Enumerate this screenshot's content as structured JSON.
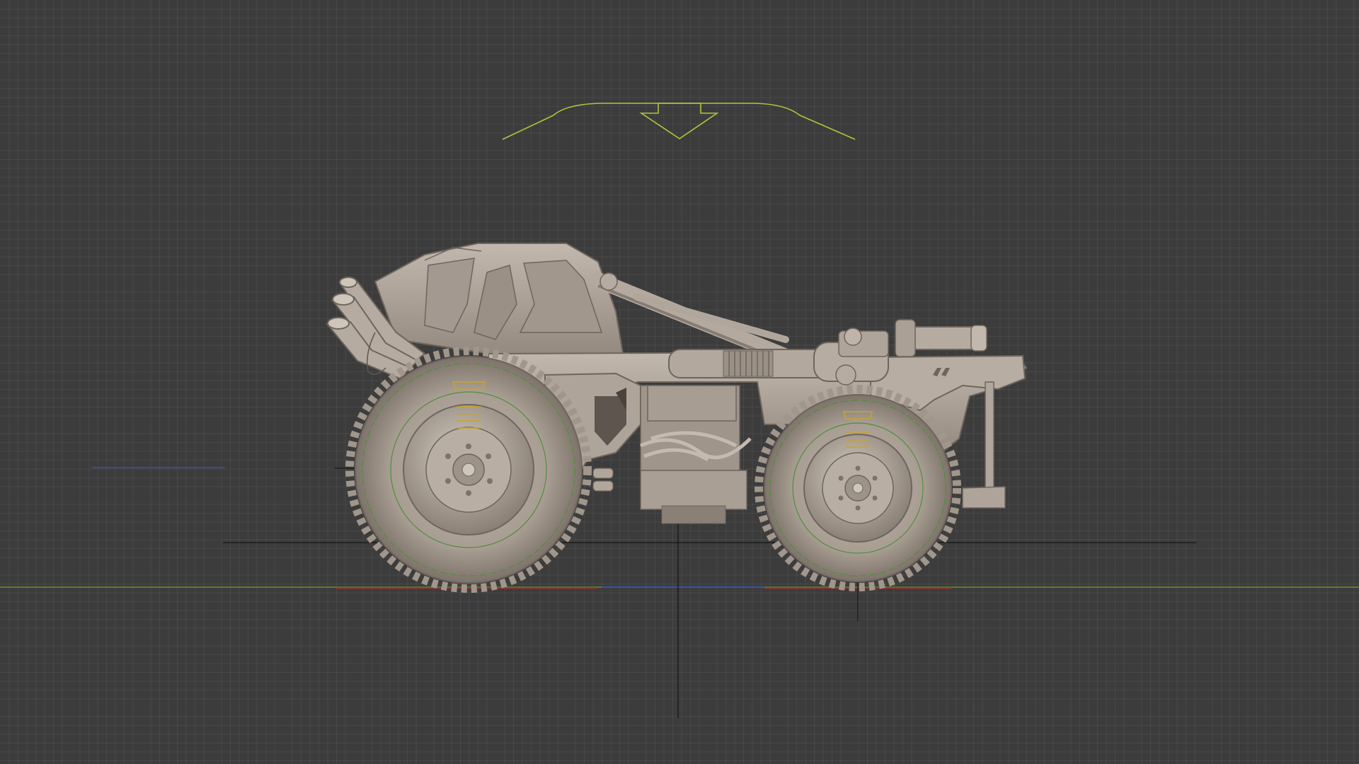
{
  "app": {
    "view": "orthographic-side-viewport",
    "visible_text": ""
  },
  "colors": {
    "background": "#3c3c3c",
    "grid_minor": "#4a4a4a",
    "grid_major": "#2f2f2f",
    "axis_green": "#6a8f2a",
    "axis_red": "#b03030",
    "axis_blue": "#3a4fb0",
    "camera_gizmo": "#b3c43a",
    "model_base": "#a89d92",
    "model_dark": "#6e655d",
    "model_light": "#cfc6bb",
    "wireframe_green": "#4f8f3a",
    "wireframe_yellow": "#c8a42a"
  },
  "objects": [
    {
      "name": "vehicle-model",
      "kind": "mesh"
    },
    {
      "name": "camera-gizmo",
      "kind": "camera-frustum"
    },
    {
      "name": "front-wheel",
      "kind": "mesh"
    },
    {
      "name": "rear-wheel",
      "kind": "mesh"
    }
  ]
}
